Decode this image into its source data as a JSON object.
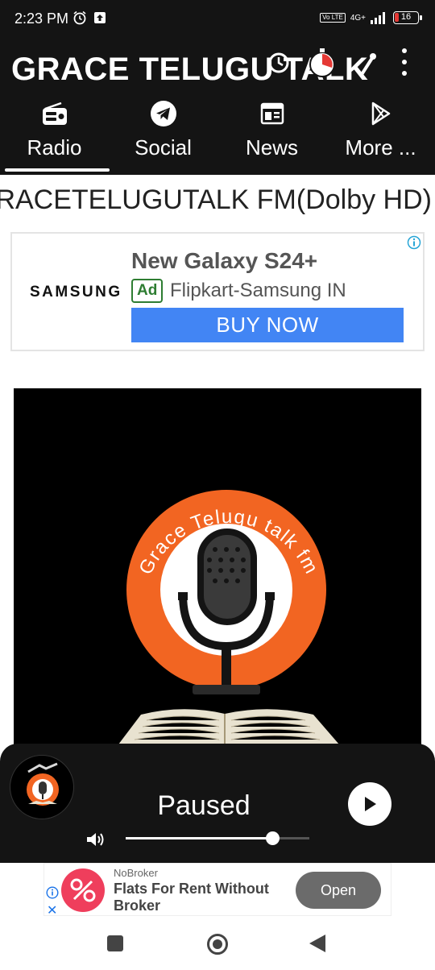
{
  "status_bar": {
    "time": "2:23 PM",
    "lte_label": "Vo LTE",
    "network": "4G+",
    "battery": "16"
  },
  "app": {
    "title": "GRACE TELUGU TALK"
  },
  "tabs": [
    {
      "label": "Radio",
      "icon": "radio-icon",
      "selected": true
    },
    {
      "label": "Social",
      "icon": "telegram-icon",
      "selected": false
    },
    {
      "label": "News",
      "icon": "newspaper-icon",
      "selected": false
    },
    {
      "label": "More ...",
      "icon": "play-store-icon",
      "selected": false
    }
  ],
  "station": {
    "marquee": "GRACETELUGUTALK FM(Dolby HD)"
  },
  "ad_banner": {
    "brand": "SAMSUNG",
    "headline": "New Galaxy S24+",
    "badge": "Ad",
    "advertiser": "Flipkart-Samsung IN",
    "cta": "BUY NOW"
  },
  "artwork": {
    "logo_text": "Grace Telugu talk fm"
  },
  "player": {
    "status": "Paused",
    "volume": 0.8
  },
  "bottom_ad": {
    "brand": "NoBroker",
    "text": "Flats For Rent Without Broker",
    "cta": "Open"
  },
  "colors": {
    "app_bar": "#141414",
    "accent_orange": "#f26522",
    "ad_button": "#4285f4",
    "ad_badge_green": "#2e7d32"
  }
}
